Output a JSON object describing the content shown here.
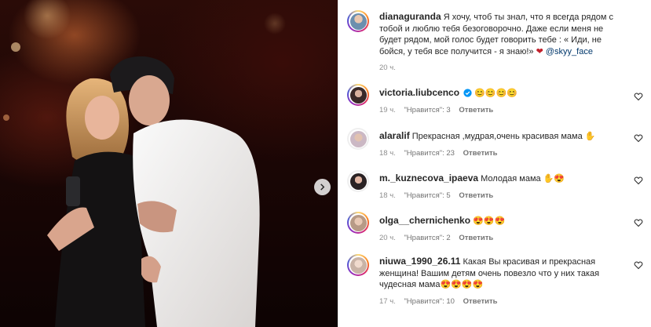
{
  "post": {
    "author": "dianaguranda",
    "caption": "Я хочу, чтоб ты знал, что я всегда рядом с тобой и люблю тебя безоговорочно. Даже если меня не будет рядом, мой голос будет говорить тебе : « Иди, не бойся, у тебя все получится - я знаю!»",
    "heart": "❤",
    "mention": "@skyy_face",
    "time": "20 ч."
  },
  "comments": [
    {
      "user": "victoria.liubcenco",
      "verified": true,
      "text": "😊😊😊😊",
      "time": "19 ч.",
      "likes": "\"Нравится\": 3",
      "reply": "Ответить"
    },
    {
      "user": "alaralif",
      "verified": false,
      "text": "Прекрасная ,мудрая,очень красивая мама ✋",
      "time": "18 ч.",
      "likes": "\"Нравится\": 23",
      "reply": "Ответить"
    },
    {
      "user": "m._kuznecova_ipaeva",
      "verified": false,
      "text": "Молодая мама ✋😍",
      "time": "18 ч.",
      "likes": "\"Нравится\": 5",
      "reply": "Ответить"
    },
    {
      "user": "olga__chernichenko",
      "verified": false,
      "text": "😍😍😍",
      "time": "20 ч.",
      "likes": "\"Нравится\": 2",
      "reply": "Ответить"
    },
    {
      "user": "niuwa_1990_26.11",
      "verified": false,
      "text": "Какая Вы красивая и прекрасная женщина! Вашим детям очень повезло что у них такая чудесная мама😍😍😍😍",
      "time": "17 ч.",
      "likes": "\"Нравится\": 10",
      "reply": "Ответить"
    }
  ],
  "icons": {
    "next": "chevron-right-icon",
    "like": "heart-outline-icon",
    "verified": "verified-badge-icon"
  },
  "colors": {
    "verified": "#0095f6",
    "mention": "#00376b",
    "heart": "#c2202b"
  }
}
